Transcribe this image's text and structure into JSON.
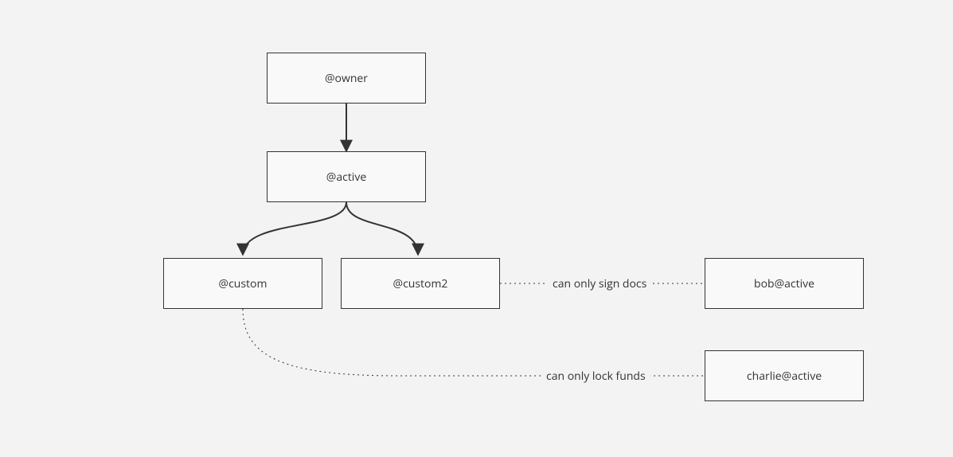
{
  "diagram": {
    "nodes": {
      "owner": {
        "label": "@owner"
      },
      "active": {
        "label": "@active"
      },
      "custom": {
        "label": "@custom"
      },
      "custom2": {
        "label": "@custom2"
      },
      "bob": {
        "label": "bob@active"
      },
      "charlie": {
        "label": "charlie@active"
      }
    },
    "edges": {
      "owner_active": {
        "from": "owner",
        "to": "active",
        "style": "solid-arrow"
      },
      "active_custom": {
        "from": "active",
        "to": "custom",
        "style": "solid-arrow"
      },
      "active_custom2": {
        "from": "active",
        "to": "custom2",
        "style": "solid-arrow"
      },
      "custom2_bob": {
        "from": "custom2",
        "to": "bob",
        "style": "dotted",
        "label": "can only sign docs"
      },
      "custom_charlie": {
        "from": "custom",
        "to": "charlie",
        "style": "dotted",
        "label": "can only lock funds"
      }
    }
  }
}
